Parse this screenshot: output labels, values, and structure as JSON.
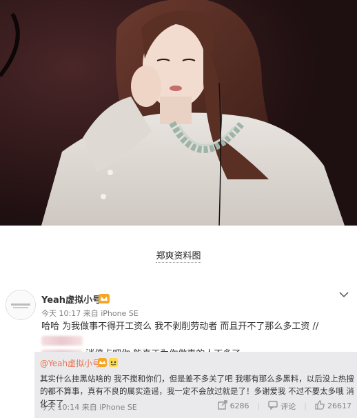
{
  "caption": "郑爽资料图",
  "post": {
    "username": "Yeah虚拟小号",
    "meta": "今天 10:17 来自 iPhone SE",
    "text_line1": "哈哈 为我做事不得开工资么 我不剥削劳动者 而且开不了那么多工资 //",
    "text_line2": "消停点吧你  能真正为你做事的人不多了"
  },
  "repost": {
    "username": "@Yeah虚拟小号",
    "text": "其实什么挂黑站啥的 我不搅和你们，但是差不多关了吧 我哪有那么多黑料，以后没上热搜的都不算事，真有不良的属实造谣，我一定不会放过就是了！多谢爱我 不过不要太多哦 消化不了",
    "meta": "今天 10:14 来自 iPhone SE",
    "share_count": "6286",
    "comment_label": "评论",
    "like_count": "26617"
  },
  "colors": {
    "link": "#eb7350",
    "meta": "#808080",
    "repost_bg": "#eaeaec"
  },
  "icons": [
    "chevron-down-icon",
    "vip-crown-icon",
    "share-icon",
    "comment-icon",
    "like-icon"
  ]
}
